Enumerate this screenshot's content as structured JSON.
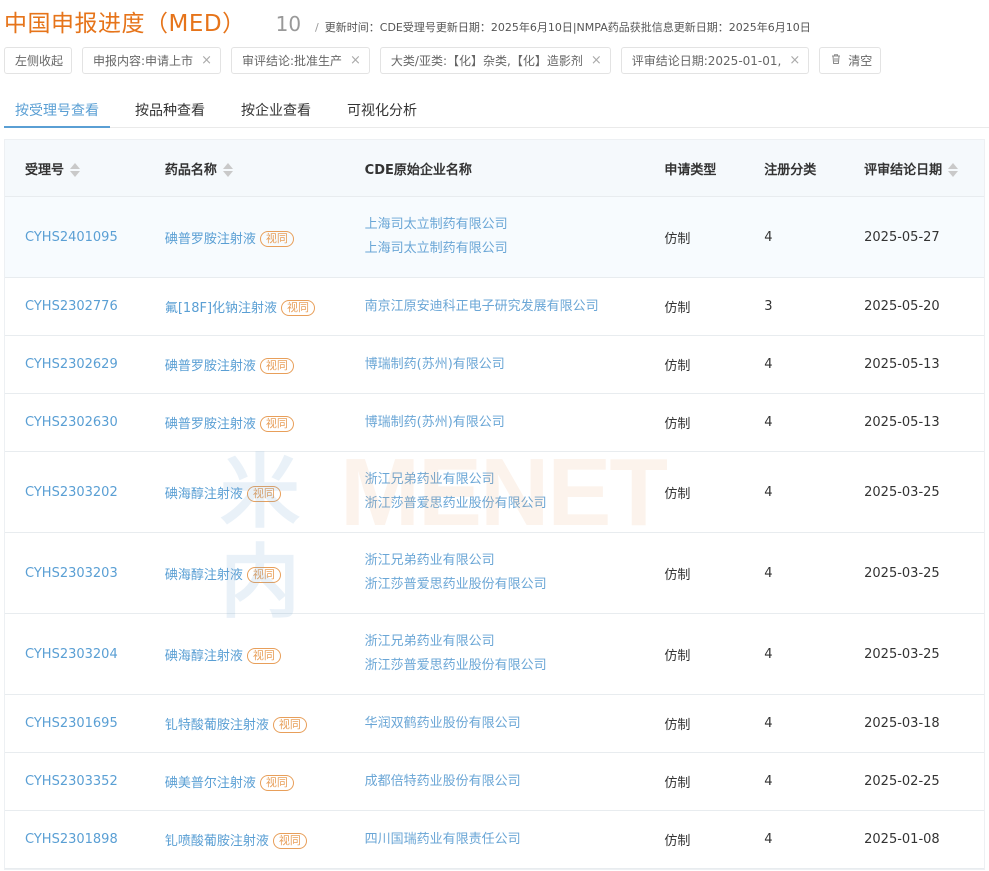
{
  "header": {
    "title": "中国申报进度（MED）",
    "count": "10",
    "separator": "/",
    "update_info": "更新时间：CDE受理号更新日期：2025年6月10日|NMPA药品获批信息更新日期：2025年6月10日"
  },
  "filters": {
    "collapse_label": "左侧收起",
    "chips": [
      {
        "label": "申报内容:申请上市"
      },
      {
        "label": "审评结论:批准生产"
      },
      {
        "label": "大类/亚类:【化】杂类,【化】造影剂"
      },
      {
        "label": "评审结论日期:2025-01-01,"
      }
    ],
    "clear_label": "清空",
    "close_icon": "×"
  },
  "tabs": [
    {
      "label": "按受理号查看",
      "active": true
    },
    {
      "label": "按品种查看",
      "active": false
    },
    {
      "label": "按企业查看",
      "active": false
    },
    {
      "label": "可视化分析",
      "active": false
    }
  ],
  "table": {
    "columns": [
      "受理号",
      "药品名称",
      "CDE原始企业名称",
      "申请类型",
      "注册分类",
      "评审结论日期"
    ],
    "badge_label": "视同",
    "rows": [
      {
        "id": "CYHS2401095",
        "drug": "碘普罗胺注射液",
        "corps": [
          "上海司太立制药有限公司",
          "上海司太立制药有限公司"
        ],
        "type": "仿制",
        "cls": "4",
        "date": "2025-05-27"
      },
      {
        "id": "CYHS2302776",
        "drug": "氟[18F]化钠注射液",
        "corps": [
          "南京江原安迪科正电子研究发展有限公司"
        ],
        "type": "仿制",
        "cls": "3",
        "date": "2025-05-20"
      },
      {
        "id": "CYHS2302629",
        "drug": "碘普罗胺注射液",
        "corps": [
          "博瑞制药(苏州)有限公司"
        ],
        "type": "仿制",
        "cls": "4",
        "date": "2025-05-13"
      },
      {
        "id": "CYHS2302630",
        "drug": "碘普罗胺注射液",
        "corps": [
          "博瑞制药(苏州)有限公司"
        ],
        "type": "仿制",
        "cls": "4",
        "date": "2025-05-13"
      },
      {
        "id": "CYHS2303202",
        "drug": "碘海醇注射液",
        "corps": [
          "浙江兄弟药业有限公司",
          "浙江莎普爱思药业股份有限公司"
        ],
        "type": "仿制",
        "cls": "4",
        "date": "2025-03-25"
      },
      {
        "id": "CYHS2303203",
        "drug": "碘海醇注射液",
        "corps": [
          "浙江兄弟药业有限公司",
          "浙江莎普爱思药业股份有限公司"
        ],
        "type": "仿制",
        "cls": "4",
        "date": "2025-03-25"
      },
      {
        "id": "CYHS2303204",
        "drug": "碘海醇注射液",
        "corps": [
          "浙江兄弟药业有限公司",
          "浙江莎普爱思药业股份有限公司"
        ],
        "type": "仿制",
        "cls": "4",
        "date": "2025-03-25"
      },
      {
        "id": "CYHS2301695",
        "drug": "钆特酸葡胺注射液",
        "corps": [
          "华润双鹤药业股份有限公司"
        ],
        "type": "仿制",
        "cls": "4",
        "date": "2025-03-18"
      },
      {
        "id": "CYHS2303352",
        "drug": "碘美普尔注射液",
        "corps": [
          "成都倍特药业股份有限公司"
        ],
        "type": "仿制",
        "cls": "4",
        "date": "2025-02-25"
      },
      {
        "id": "CYHS2301898",
        "drug": "钆喷酸葡胺注射液",
        "corps": [
          "四川国瑞药业有限责任公司"
        ],
        "type": "仿制",
        "cls": "4",
        "date": "2025-01-08"
      }
    ]
  },
  "watermark": {
    "text": "MENET",
    "mark": "米内"
  },
  "colors": {
    "accent": "#e6741a",
    "link": "#5a9fd4",
    "badge": "#e89f5a"
  }
}
